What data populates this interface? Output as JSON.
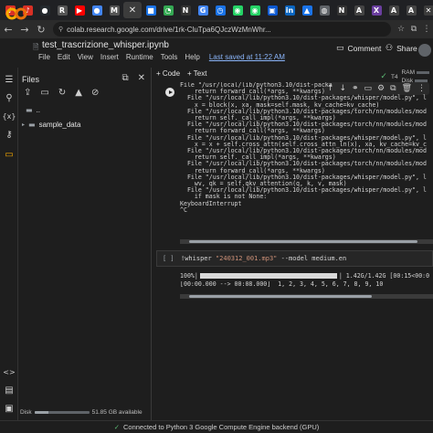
{
  "browser": {
    "tabs": [
      {
        "glyph": "♪",
        "color": "#d93025"
      },
      {
        "glyph": "♪",
        "color": "#d93025"
      },
      {
        "glyph": "●",
        "color": "#24292e"
      },
      {
        "glyph": "R",
        "color": "#555555"
      },
      {
        "glyph": "▶",
        "color": "#ff0000"
      },
      {
        "glyph": "●",
        "color": "#4285f4"
      },
      {
        "glyph": "M",
        "color": "#555555"
      },
      {
        "glyph": "✕",
        "color": "#3c3c3c",
        "active": true
      },
      {
        "glyph": "■",
        "color": "#1a73e8"
      },
      {
        "glyph": "◔",
        "color": "#34a853"
      },
      {
        "glyph": "N",
        "color": "#333333"
      },
      {
        "glyph": "G",
        "color": "#4285f4"
      },
      {
        "glyph": "◷",
        "color": "#1a73e8"
      },
      {
        "glyph": "◉",
        "color": "#25d366"
      },
      {
        "glyph": "◉",
        "color": "#25d366"
      },
      {
        "glyph": "▣",
        "color": "#0b57d0"
      },
      {
        "glyph": "in",
        "color": "#0a66c2"
      },
      {
        "glyph": "▲",
        "color": "#1a73e8"
      },
      {
        "glyph": "◍",
        "color": "#5f6368"
      },
      {
        "glyph": "N",
        "color": "#333333"
      },
      {
        "glyph": "A",
        "color": "#444444"
      },
      {
        "glyph": "X",
        "color": "#6b3fa0"
      },
      {
        "glyph": "A",
        "color": "#444444"
      },
      {
        "glyph": "A",
        "color": "#444444"
      },
      {
        "glyph": "✕",
        "color": "#3c3c3c"
      }
    ],
    "url": "colab.research.google.com/drive/1rk-CluTpa6QJczWzMnWhr..."
  },
  "colab": {
    "notebook_title": "test_trascrizione_whisper.ipynb",
    "menu": [
      "File",
      "Edit",
      "View",
      "Insert",
      "Runtime",
      "Tools",
      "Help"
    ],
    "last_saved": "Last saved at 11:22 AM",
    "comment_label": "Comment",
    "share_label": "Share"
  },
  "files_panel": {
    "title": "Files",
    "tree": [
      {
        "name": "..",
        "type": "folder"
      },
      {
        "name": "sample_data",
        "type": "folder"
      }
    ],
    "disk_label": "Disk",
    "disk_available": "51.85 GB available",
    "disk_used_fraction": 0.25
  },
  "toolbar": {
    "code_label": "+ Code",
    "text_label": "+ Text",
    "runtime_type": "T4",
    "ram_label": "RAM",
    "disk_label": "Disk"
  },
  "cell1_output": "File \"/usr/local/lib/python3.10/dist-packa\n    return forward_call(*args, **kwargs)\n  File \"/usr/local/lib/python3.10/dist-packages/whisper/model.py\", l\n    x = block(x, xa, mask=self.mask, kv_cache=kv_cache)\n  File \"/usr/local/lib/python3.10/dist-packages/torch/nn/modules/mod\n    return self._call_impl(*args, **kwargs)\n  File \"/usr/local/lib/python3.10/dist-packages/torch/nn/modules/mod\n    return forward_call(*args, **kwargs)\n  File \"/usr/local/lib/python3.10/dist-packages/whisper/model.py\", l\n    x = x + self.cross_attn(self.cross_attn_ln(x), xa, kv_cache=kv_c\n  File \"/usr/local/lib/python3.10/dist-packages/torch/nn/modules/mod\n    return self._call_impl(*args, **kwargs)\n  File \"/usr/local/lib/python3.10/dist-packages/torch/nn/modules/mod\n    return forward_call(*args, **kwargs)\n  File \"/usr/local/lib/python3.10/dist-packages/whisper/model.py\", l\n    wv, qk = self.qkv_attention(q, k, v, mask)\n  File \"/usr/local/lib/python3.10/dist-packages/whisper/model.py\", l\n    if mask is not None:\nKeyboardInterrupt\n^C",
  "cell2": {
    "label": "[ ]",
    "code_prefix": "!whisper ",
    "code_string": "\"240312_001.mp3\"",
    "code_suffix": " --model medium.en"
  },
  "cell2_output": {
    "progress_prefix": "100%|",
    "progress_fraction": 1.0,
    "progress_suffix": "| 1.42G/1.42G [00:15<00:0",
    "transcript_line": "[00:00.000 --> 00:08.000]  1, 2, 3, 4, 5, 6, 7, 8, 9, 10"
  },
  "status": {
    "text": "Connected to Python 3 Google Compute Engine backend (GPU)"
  }
}
